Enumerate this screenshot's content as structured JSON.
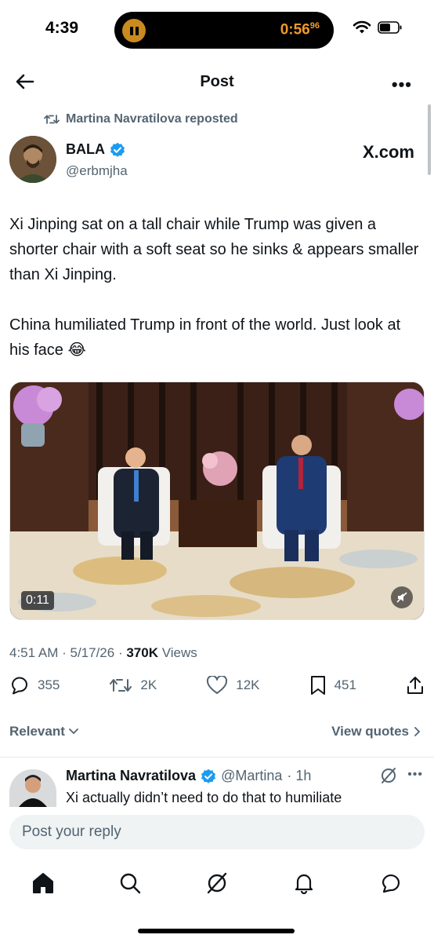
{
  "status": {
    "time": "4:39",
    "timer_main": "0:56",
    "timer_sup": "96"
  },
  "header": {
    "title": "Post"
  },
  "repost": {
    "text": "Martina Navratilova reposted"
  },
  "author": {
    "name": "BALA",
    "handle": "@erbmjha",
    "verified": true,
    "badge_color": "#1d9bf0"
  },
  "source_label": "X.com",
  "tweet": {
    "paragraph1": "Xi Jinping sat on a tall chair while Trump was given a shorter chair with a soft seat so he sinks & appears smaller than Xi Jinping.",
    "paragraph2": "China humiliated Trump in front of the world. Just look at his face 😂"
  },
  "media": {
    "duration": "0:11",
    "muted": true
  },
  "meta": {
    "time": "4:51 AM",
    "date": "5/17/26",
    "views_count": "370K",
    "views_label": "Views"
  },
  "actions": {
    "replies": "355",
    "reposts": "2K",
    "likes": "12K",
    "bookmarks": "451"
  },
  "sort": {
    "relevant": "Relevant",
    "view_quotes": "View quotes"
  },
  "reply": {
    "name": "Martina Navratilova",
    "handle": "@Martina",
    "age": "· 1h",
    "text": "Xi actually didn’t need to do that to humiliate"
  },
  "composer": {
    "placeholder": "Post your reply"
  },
  "tabbar": {
    "items": [
      "home-icon",
      "search-icon",
      "grok-icon",
      "notifications-icon",
      "messages-icon"
    ]
  },
  "colors": {
    "accent": "#1d9bf0",
    "secondary_text": "#536471",
    "timer": "#f09a2c"
  }
}
